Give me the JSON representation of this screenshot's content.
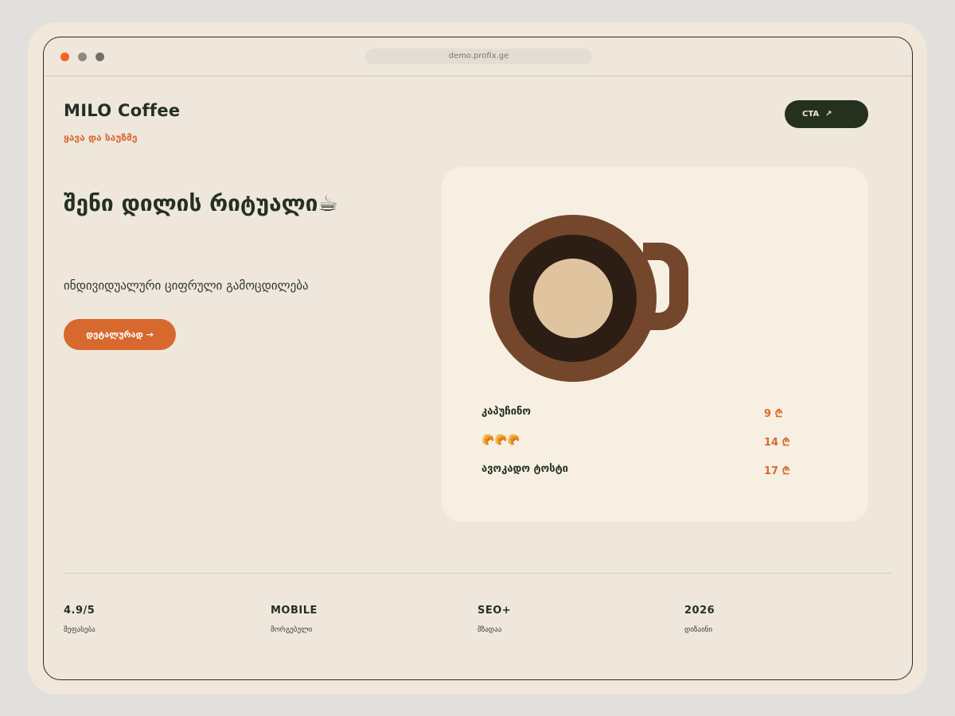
{
  "browser": {
    "url": "demo.profix.ge"
  },
  "header": {
    "brand": "MILO Coffee",
    "tagline": "ყავა და საუზმე",
    "cta_label": "CTA",
    "cta_arrow": "↗"
  },
  "hero": {
    "title": "შენი დილის რიტუალი☕",
    "subtitle": "ინდივიდუალური ციფრული გამოცდილება",
    "button_label": "დეტალურად →"
  },
  "menu": {
    "items": [
      {
        "name": "კაპუჩინო",
        "price": "9 ₾"
      },
      {
        "name": "🥐🥐🥐",
        "price": "14 ₾"
      },
      {
        "name": "ავოკადო ტოსტი",
        "price": "17 ₾"
      }
    ]
  },
  "stats": [
    {
      "value": "4.9/5",
      "label": "შეფასება"
    },
    {
      "value": "MOBILE",
      "label": "მორგებული"
    },
    {
      "value": "SEO+",
      "label": "მზადაა"
    },
    {
      "value": "2026",
      "label": "დიზაინი"
    }
  ],
  "colors": {
    "accent": "#d7692f",
    "dark": "#26301f",
    "background": "#efe7db",
    "card": "#f7f0e2",
    "cup_outer": "#74472c",
    "cup_inner": "#2c1e15",
    "foam": "#dfc49f"
  }
}
